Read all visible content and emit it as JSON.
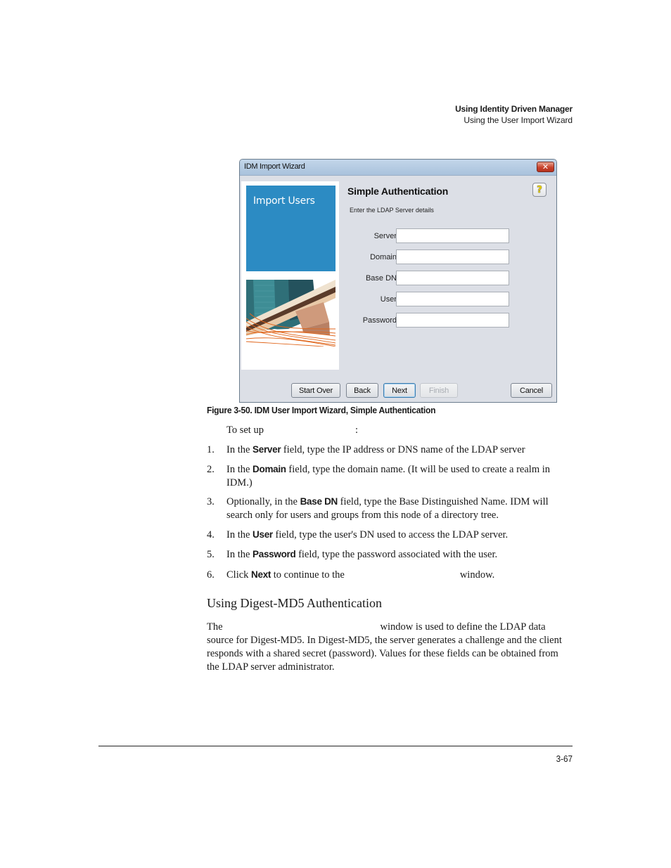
{
  "running_head": {
    "title": "Using Identity Driven Manager",
    "subtitle": "Using the User Import Wizard"
  },
  "wizard": {
    "window_title": "IDM Import Wizard",
    "close_glyph": "✕",
    "side_banner_label": "Import Users",
    "page_heading": "Simple Authentication",
    "page_subtitle": "Enter the LDAP Server details",
    "help_glyph": "?",
    "fields": [
      {
        "label": "Server",
        "value": ""
      },
      {
        "label": "Domain",
        "value": ""
      },
      {
        "label": "Base DN",
        "value": ""
      },
      {
        "label": "User",
        "value": ""
      },
      {
        "label": "Password",
        "value": ""
      }
    ],
    "buttons": {
      "start_over": "Start Over",
      "back": "Back",
      "next": "Next",
      "finish": "Finish",
      "cancel": "Cancel"
    },
    "colors": {
      "banner_blue": "#2c8bc3",
      "dialog_bg": "#dcdfe6"
    }
  },
  "caption": "Figure 3-50. IDM User Import Wizard, Simple Authentication",
  "intro": {
    "before": "To set up",
    "after": ":"
  },
  "steps": [
    {
      "num": "1.",
      "pre": "In the ",
      "bold": "Server",
      "post": " field, type the IP address or DNS name of the LDAP server"
    },
    {
      "num": "2.",
      "pre": "In the ",
      "bold": "Domain",
      "post": " field, type the domain name. (It will be used to create a realm in IDM.)"
    },
    {
      "num": "3.",
      "pre": "Optionally, in the ",
      "bold": "Base DN",
      "post": " field, type the Base Distinguished Name. IDM will search only for users and groups from this node of a directory tree."
    },
    {
      "num": "4.",
      "pre": "In the ",
      "bold": "User",
      "post": " field, type the user's DN used to access the LDAP server."
    },
    {
      "num": "5.",
      "pre": "In the ",
      "bold": "Password",
      "post": " field, type the password associated with the user."
    },
    {
      "num": "6.",
      "pre": "Click ",
      "bold": "Next",
      "post": " to continue to the",
      "post2": "window."
    }
  ],
  "section": {
    "heading": "Using Digest-MD5 Authentication",
    "para_start": "The",
    "para_rest": "window is used to define the LDAP data source for Digest-MD5. In Digest-MD5, the server generates a challenge and the client responds with a shared secret (password). Values for these fields can be obtained from the LDAP server administrator."
  },
  "footer": {
    "page_number": "3-67"
  }
}
